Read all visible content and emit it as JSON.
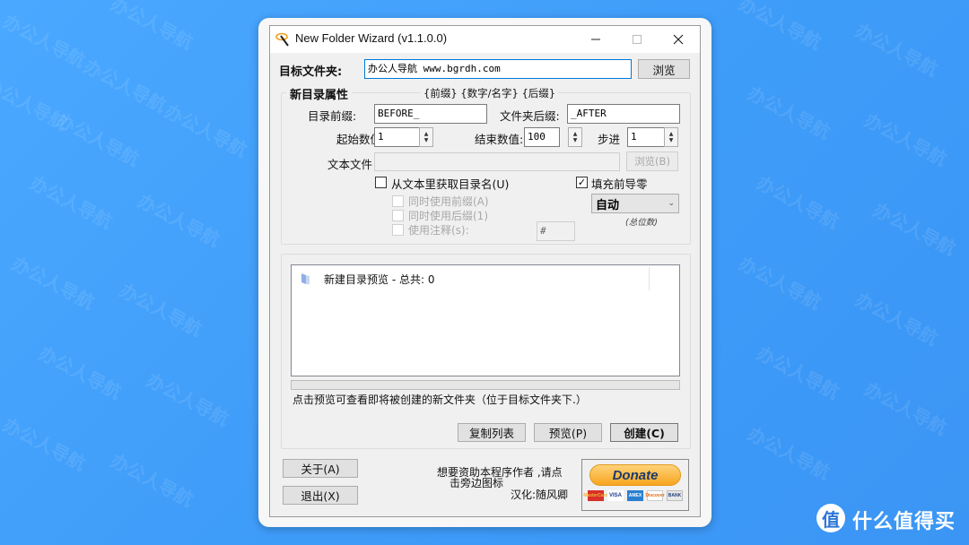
{
  "background": {
    "watermark_text": "办公人导航",
    "color": "#44a3fb"
  },
  "window": {
    "title": "New Folder Wizard  (v1.1.0.0)",
    "minimize_icon": "minimize-icon",
    "maximize_icon": "maximize-icon",
    "close_icon": "close-icon"
  },
  "target": {
    "label": "目标文件夹:",
    "value": "办公人导航 www.bgrdh.com",
    "browse_label": "浏览"
  },
  "properties": {
    "group_title": "新目录属性",
    "pattern_hint": "{前缀} {数字/名字} {后缀}",
    "prefix_label": "目录前缀:",
    "prefix_value": "BEFORE_",
    "suffix_label": "文件夹后缀:",
    "suffix_value": "_AFTER",
    "start_label": "起始数值",
    "start_value": "1",
    "end_label": "结束数值:",
    "end_value": "100",
    "step_label": "步进",
    "step_value": "1",
    "textfile_label": "文本文件",
    "textfile_value": "",
    "textfile_browse_label": "浏览(B)",
    "from_text_label": "从文本里获取目录名(U)",
    "from_text_checked": false,
    "use_prefix_label": "同时使用前缀(A)",
    "use_suffix_label": "同时使用后缀(1)",
    "use_comment_label": "使用注释(s):",
    "comment_value": "#",
    "pad_zero_label": "填充前导零",
    "pad_zero_checked": true,
    "digits_selected": "自动",
    "digits_caption": "(总位数)"
  },
  "preview": {
    "header": "新建目录预览 - 总共: 0",
    "total": 0,
    "progress": 0,
    "hint": "点击预览可查看即将被创建的新文件夹（位于目标文件夹下.）",
    "copy_label": "复制列表",
    "preview_label": "预览(P)",
    "create_label": "创建(C)"
  },
  "footer": {
    "about_label": "关于(A)",
    "exit_label": "退出(X)",
    "donate_text_line1": "想要资助本程序作者 ,请点",
    "donate_text_line2": "击旁边图标",
    "translator": "汉化:随风卿",
    "donate_label": "Donate",
    "payment_cards": [
      "MasterCard",
      "VISA",
      "AMEX",
      "Discover",
      "BANK"
    ]
  },
  "brand": {
    "badge": "值",
    "name": "什么值得买"
  }
}
